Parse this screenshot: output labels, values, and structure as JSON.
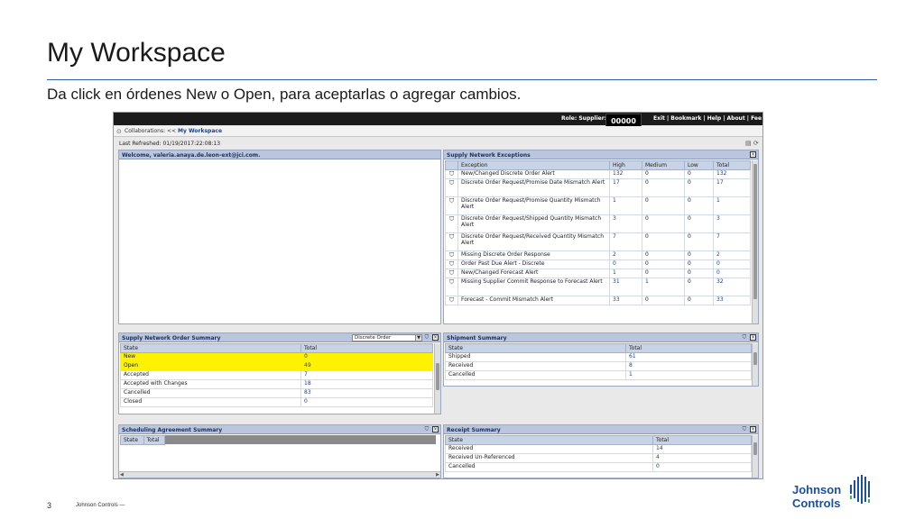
{
  "slide": {
    "title": "My Workspace",
    "subtitle": "Da click en órdenes New o Open, para aceptarlas o agregar cambios.",
    "page_number": "3",
    "footer_company": "Johnson Controls",
    "footer_dash": "—",
    "logo_line1": "Johnson",
    "logo_line2": "Controls",
    "accent_color": "#2b5ea8"
  },
  "app": {
    "topbar": {
      "role_label": "Role: Supplier:",
      "supplier_code": "00000",
      "links": "Exit | Bookmark | Help | About | Fee"
    },
    "breadcrumb": {
      "prefix": "Collaborations: <<",
      "current": "My Workspace"
    },
    "last_refreshed": "Last Refreshed: 01/19/2017:22:08:13",
    "welcome_title": "Welcome, valeria.anaya.de.leon-ext@jci.com.",
    "exceptions": {
      "title": "Supply Network Exceptions",
      "headers": [
        "Exception",
        "High",
        "Medium",
        "Low",
        "Total"
      ],
      "rows": [
        {
          "exception": "New/Changed Discrete Order Alert",
          "high": "132",
          "medium": "0",
          "low": "0",
          "total": "132",
          "tall": false
        },
        {
          "exception": "Discrete Order Request/Promise Date Mismatch Alert",
          "high": "17",
          "medium": "0",
          "low": "0",
          "total": "17",
          "tall": true
        },
        {
          "exception": "Discrete Order Request/Promise Quantity Mismatch Alert",
          "high": "1",
          "medium": "0",
          "low": "0",
          "total": "1",
          "tall": true
        },
        {
          "exception": "Discrete Order Request/Shipped Quantity Mismatch Alert",
          "high": "3",
          "medium": "0",
          "low": "0",
          "total": "3",
          "tall": true
        },
        {
          "exception": "Discrete Order Request/Received Quantity Mismatch Alert",
          "high": "7",
          "medium": "0",
          "low": "0",
          "total": "7",
          "tall": true
        },
        {
          "exception": "Missing Discrete Order Response",
          "high": "2",
          "medium": "0",
          "low": "0",
          "total": "2",
          "tall": false
        },
        {
          "exception": "Order Past Due Alert - Discrete",
          "high": "0",
          "medium": "0",
          "low": "0",
          "total": "0",
          "tall": false
        },
        {
          "exception": "New/Changed Forecast Alert",
          "high": "1",
          "medium": "0",
          "low": "0",
          "total": "0",
          "tall": false
        },
        {
          "exception": "Missing Supplier Commit Response to Forecast Alert",
          "high": "31",
          "medium": "1",
          "low": "0",
          "total": "32",
          "tall": true
        },
        {
          "exception": "Forecast - Commit Mismatch Alert",
          "high": "33",
          "medium": "0",
          "low": "0",
          "total": "33",
          "tall": false
        }
      ]
    },
    "order_summary": {
      "title": "Supply Network Order Summary",
      "select_value": "Discrete Order",
      "headers": [
        "State",
        "Total"
      ],
      "rows": [
        {
          "state": "New",
          "total": "0",
          "highlight": true
        },
        {
          "state": "Open",
          "total": "49",
          "highlight": true
        },
        {
          "state": "Accepted",
          "total": "7",
          "highlight": false
        },
        {
          "state": "Accepted with Changes",
          "total": "18",
          "highlight": false
        },
        {
          "state": "Cancelled",
          "total": "83",
          "highlight": false
        },
        {
          "state": "Closed",
          "total": "0",
          "highlight": false
        }
      ]
    },
    "shipment_summary": {
      "title": "Shipment Summary",
      "headers": [
        "State",
        "Total"
      ],
      "rows": [
        {
          "state": "Shipped",
          "total": "61"
        },
        {
          "state": "Received",
          "total": "8"
        },
        {
          "state": "Cancelled",
          "total": "1"
        }
      ]
    },
    "scheduling_summary": {
      "title": "Scheduling Agreement Summary",
      "headers": [
        "State",
        "Total"
      ]
    },
    "receipt_summary": {
      "title": "Receipt Summary",
      "headers": [
        "State",
        "Total"
      ],
      "rows": [
        {
          "state": "Received",
          "total": "14"
        },
        {
          "state": "Received Un-Referenced",
          "total": "4"
        },
        {
          "state": "Cancelled",
          "total": "0"
        }
      ]
    }
  }
}
